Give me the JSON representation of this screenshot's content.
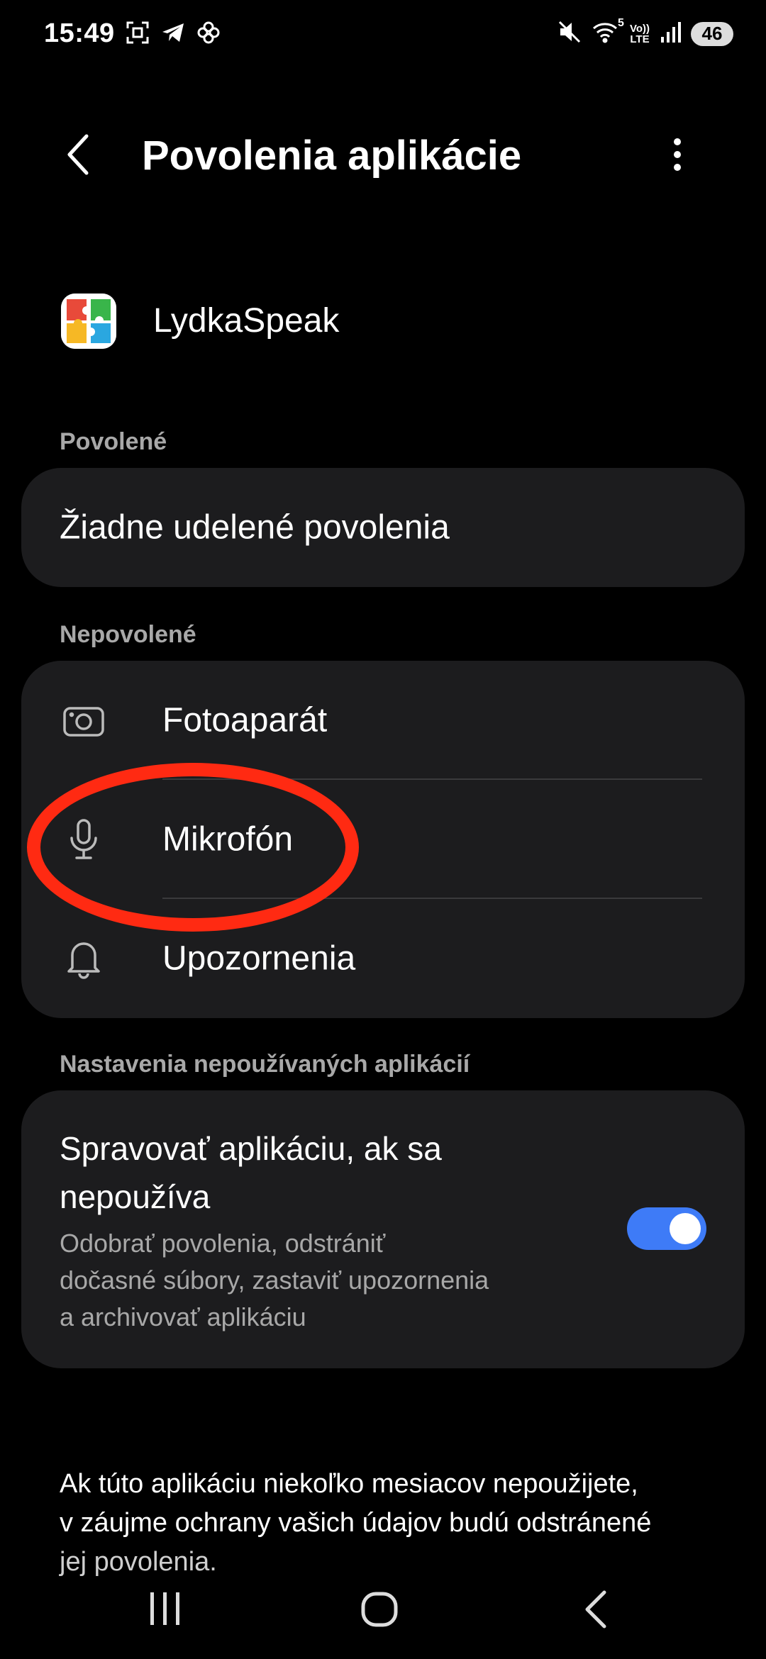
{
  "status_bar": {
    "time": "15:49",
    "left_icons": [
      "screenshot-icon",
      "telegram-icon",
      "pinwheel-icon"
    ],
    "right_icons": [
      "mute-icon",
      "wifi-icon",
      "volte-icon",
      "signal-icon"
    ],
    "wifi_label": "5",
    "volte_label_top": "Vo))",
    "volte_label_bottom": "LTE",
    "battery": "46"
  },
  "header": {
    "title": "Povolenia aplikácie"
  },
  "app": {
    "name": "LydkaSpeak",
    "icon": "puzzle-app-icon"
  },
  "allowed": {
    "section_label": "Povolené",
    "empty_text": "Žiadne udelené povolenia"
  },
  "denied": {
    "section_label": "Nepovolené",
    "items": [
      {
        "label": "Fotoaparát",
        "icon": "camera-icon"
      },
      {
        "label": "Mikrofón",
        "icon": "microphone-icon"
      },
      {
        "label": "Upozornenia",
        "icon": "bell-icon"
      }
    ]
  },
  "unused": {
    "section_label": "Nastavenia nepoužívaných aplikácií",
    "title_line1": "Spravovať aplikáciu, ak sa",
    "title_line2": "nepoužíva",
    "desc_line1": "Odobrať povolenia, odstrániť",
    "desc_line2": "dočasné súbory, zastaviť upozornenia",
    "desc_line3": "a archivovať aplikáciu",
    "toggle_on": true
  },
  "footer": {
    "line1": "Ak túto aplikáciu niekoľko mesiacov nepoužijete,",
    "line2": "v záujme ochrany vašich údajov budú odstránené",
    "line3": "jej povolenia."
  },
  "colors": {
    "background": "#000000",
    "card": "#1c1c1e",
    "accent_toggle": "#3e7bf7",
    "annotation_circle": "#ff2a12",
    "secondary_text": "#a8a8a8"
  }
}
